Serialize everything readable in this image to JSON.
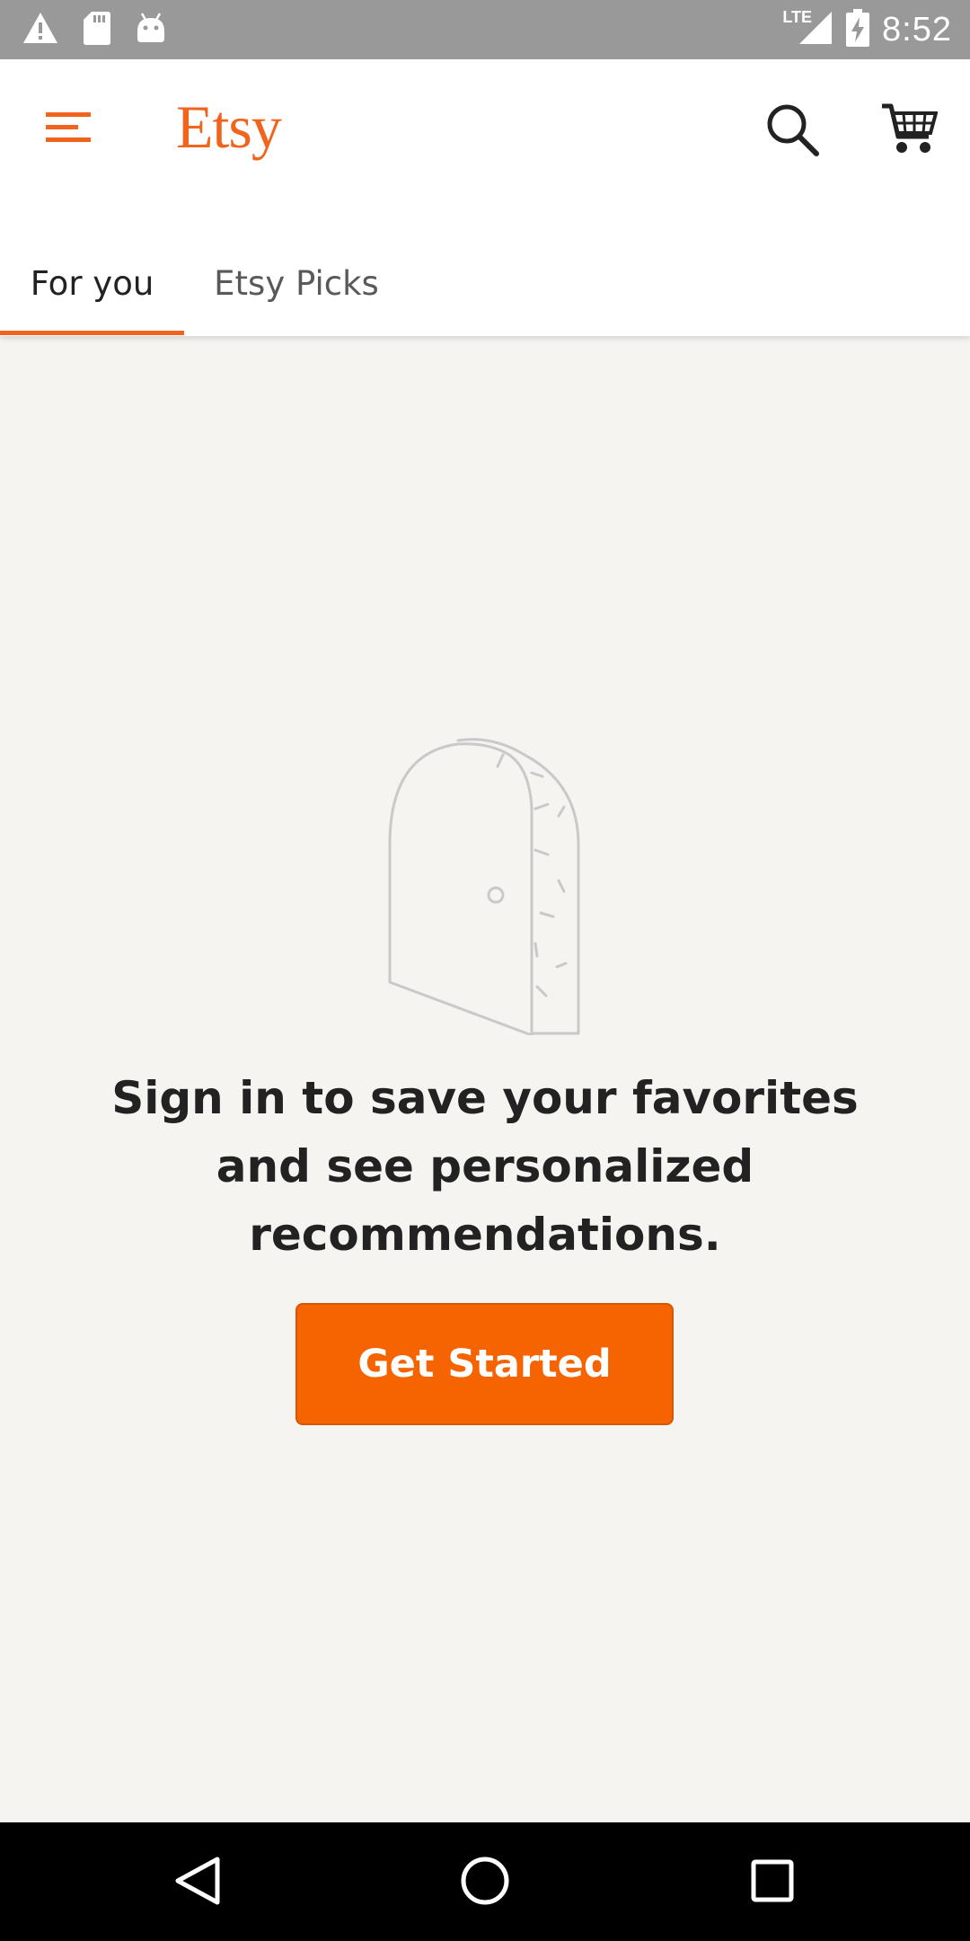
{
  "status_bar": {
    "time": "8:52",
    "network": "LTE",
    "icons": [
      "warning-icon",
      "sd-card-icon",
      "android-icon",
      "signal-icon",
      "battery-charging-icon"
    ]
  },
  "header": {
    "logo": "Etsy",
    "menu_icon": "hamburger-menu-icon",
    "search_icon": "search-icon",
    "cart_icon": "cart-icon"
  },
  "tabs": [
    {
      "label": "For you",
      "active": true
    },
    {
      "label": "Etsy Picks",
      "active": false
    }
  ],
  "main": {
    "illustration": "door-icon",
    "message": "Sign in to save your favorites and see personalized recommendations.",
    "cta_label": "Get Started"
  },
  "nav_bar": {
    "icons": [
      "back-icon",
      "home-icon",
      "recents-icon"
    ]
  },
  "colors": {
    "accent": "#f1641e",
    "button": "#f56400",
    "background": "#f5f4f1",
    "status_bar": "#999999"
  }
}
